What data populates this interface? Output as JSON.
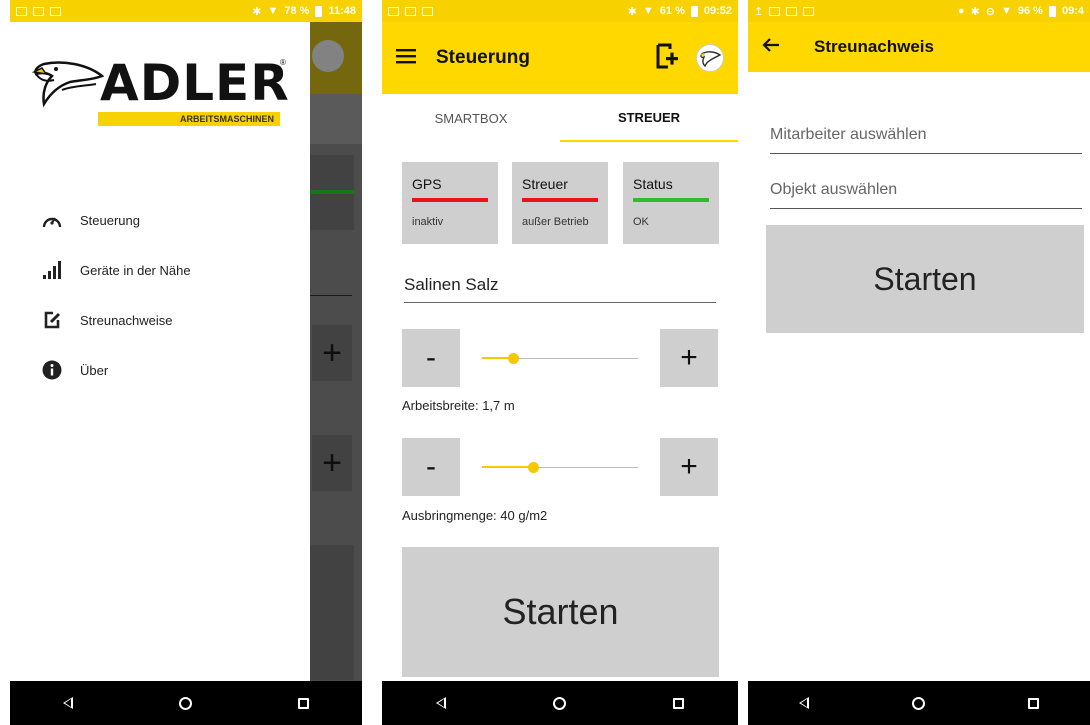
{
  "screen1": {
    "statusbar": {
      "battery": "78 %",
      "time": "11:48"
    },
    "logo": {
      "word": "ADLER",
      "tagline": "ARBEITSMASCHINEN"
    },
    "menu": [
      {
        "label": "Steuerung",
        "icon": "speedometer-icon"
      },
      {
        "label": "Geräte in der Nähe",
        "icon": "signal-bars-icon"
      },
      {
        "label": "Streunachweise",
        "icon": "edit-icon"
      },
      {
        "label": "Über",
        "icon": "info-icon"
      }
    ]
  },
  "screen2": {
    "statusbar": {
      "battery": "61 %",
      "time": "09:52"
    },
    "toolbar": {
      "title": "Steuerung"
    },
    "tabs": [
      "SMARTBOX",
      "STREUER"
    ],
    "active_tab": "STREUER",
    "status_cards": [
      {
        "title": "GPS",
        "state": "inaktiv",
        "color": "#e8131a"
      },
      {
        "title": "Streuer",
        "state": "außer Betrieb",
        "color": "#e8131a"
      },
      {
        "title": "Status",
        "state": "OK",
        "color": "#2fbd2f"
      }
    ],
    "material": "Salinen Salz",
    "slider1": {
      "minus": "-",
      "plus": "+",
      "caption": "Arbeitsbreite: 1,7 m",
      "level": 0.2
    },
    "slider2": {
      "minus": "-",
      "plus": "+",
      "caption": "Ausbringmenge: 40 g/m2",
      "level": 0.33
    },
    "start_label": "Starten"
  },
  "screen3": {
    "statusbar": {
      "battery": "96 %",
      "time": "09:4"
    },
    "toolbar": {
      "title": "Streunachweis"
    },
    "employee_placeholder": "Mitarbeiter auswählen",
    "object_placeholder": "Objekt auswählen",
    "start_label": "Starten"
  },
  "colors": {
    "accent": "#ffd800",
    "button_gray": "#cfcfcf"
  }
}
